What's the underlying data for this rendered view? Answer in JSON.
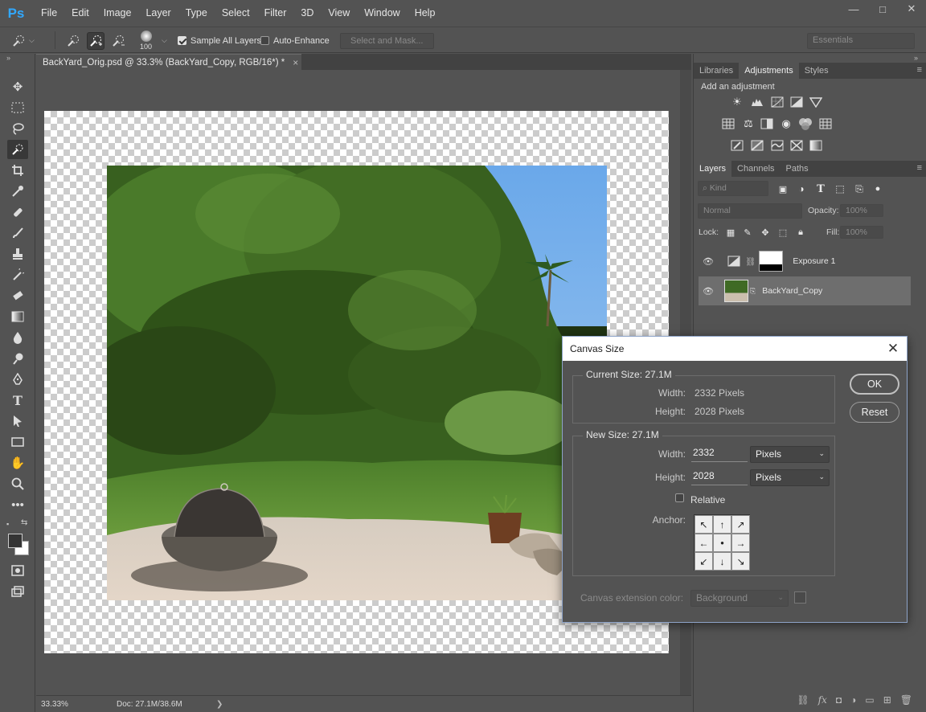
{
  "app": {
    "logo": "Ps",
    "menu": [
      "File",
      "Edit",
      "Image",
      "Layer",
      "Type",
      "Select",
      "Filter",
      "3D",
      "View",
      "Window",
      "Help"
    ],
    "window_controls": {
      "minimize": "—",
      "maximize": "□",
      "close": "✕"
    }
  },
  "options": {
    "brush_size": "100",
    "sample_all_layers_label": "Sample All Layers",
    "sample_all_layers_checked": true,
    "auto_enhance_label": "Auto-Enhance",
    "auto_enhance_checked": false,
    "select_and_mask_label": "Select and Mask...",
    "workspace": "Essentials"
  },
  "document": {
    "tab_title": "BackYard_Orig.psd @ 33.3% (BackYard_Copy, RGB/16*) *",
    "close_glyph": "×",
    "zoom": "33.33%",
    "doc_info": "Doc: 27.1M/38.6M",
    "status_arrow": "❯"
  },
  "panels": {
    "top_tabs": [
      "Libraries",
      "Adjustments",
      "Styles"
    ],
    "top_active": "Adjustments",
    "add_adjustment_label": "Add an adjustment",
    "layers_tabs": [
      "Layers",
      "Channels",
      "Paths"
    ],
    "layers_active": "Layers",
    "filter_kind": "Kind",
    "blend_mode": "Normal",
    "opacity_label": "Opacity:",
    "opacity_value": "100%",
    "lock_label": "Lock:",
    "fill_label": "Fill:",
    "fill_value": "100%",
    "layers": [
      {
        "name": "Exposure 1",
        "selected": false
      },
      {
        "name": "BackYard_Copy",
        "selected": true
      }
    ]
  },
  "dialog": {
    "title": "Canvas Size",
    "current_size_label": "Current Size: 27.1M",
    "width_label": "Width:",
    "height_label": "Height:",
    "current_width": "2332 Pixels",
    "current_height": "2028 Pixels",
    "new_size_label": "New Size: 27.1M",
    "new_width_label": "Width:",
    "new_height_label": "Height:",
    "new_width": "2332",
    "new_height": "2028",
    "width_unit": "Pixels",
    "height_unit": "Pixels",
    "relative_label": "Relative",
    "relative_checked": false,
    "anchor_label": "Anchor:",
    "anchor_arrows": [
      "↖",
      "↑",
      "↗",
      "←",
      "●",
      "→",
      "↙",
      "↓",
      "↘"
    ],
    "extension_color_label": "Canvas extension color:",
    "extension_color_value": "Background",
    "ok_label": "OK",
    "reset_label": "Reset"
  },
  "colors": {
    "accent": "#31a8ff",
    "chrome": "#535353",
    "foreground_swatch": "#353535",
    "background_swatch": "#ffffff"
  }
}
